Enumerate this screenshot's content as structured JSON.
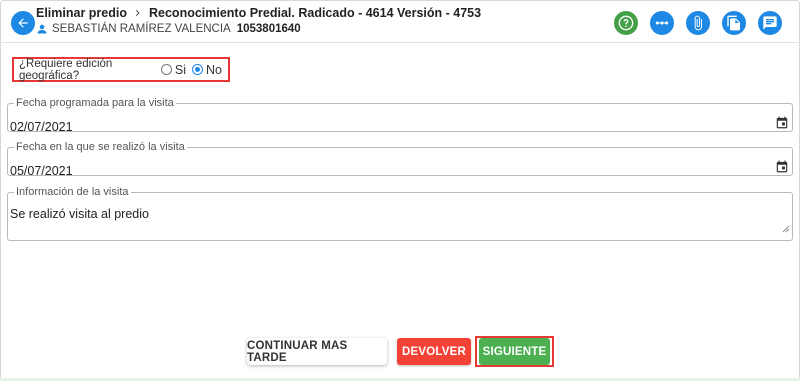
{
  "header": {
    "title_part1": "Eliminar predio",
    "title_part2": "Reconocimiento Predial. Radicado - 4614 Versión - 4753",
    "user_name": "SEBASTIÁN RAMÍREZ VALENCIA",
    "user_doc": "1053801640"
  },
  "toolbar": {
    "icons": [
      "help-icon",
      "flow-icon",
      "attachment-icon",
      "document-icon",
      "comment-icon"
    ]
  },
  "form": {
    "geo_question": "¿Requiere edición geográfica?",
    "geo_yes": "Si",
    "geo_no": "No",
    "geo_selected": "No",
    "visit_scheduled_label": "Fecha programada para la visita",
    "visit_scheduled_value": "02/07/2021",
    "visit_done_label": "Fecha en la que se realizó la visita",
    "visit_done_value": "05/07/2021",
    "visit_info_label": "Información de la visita",
    "visit_info_value": "Se realizó visita al predio"
  },
  "actions": {
    "later": "CONTINUAR MAS TARDE",
    "return": "DEVOLVER",
    "next": "SIGUIENTE"
  },
  "colors": {
    "primary": "#1e88e5",
    "success": "#4caf50",
    "danger": "#f44336",
    "highlight": "#e53935"
  }
}
